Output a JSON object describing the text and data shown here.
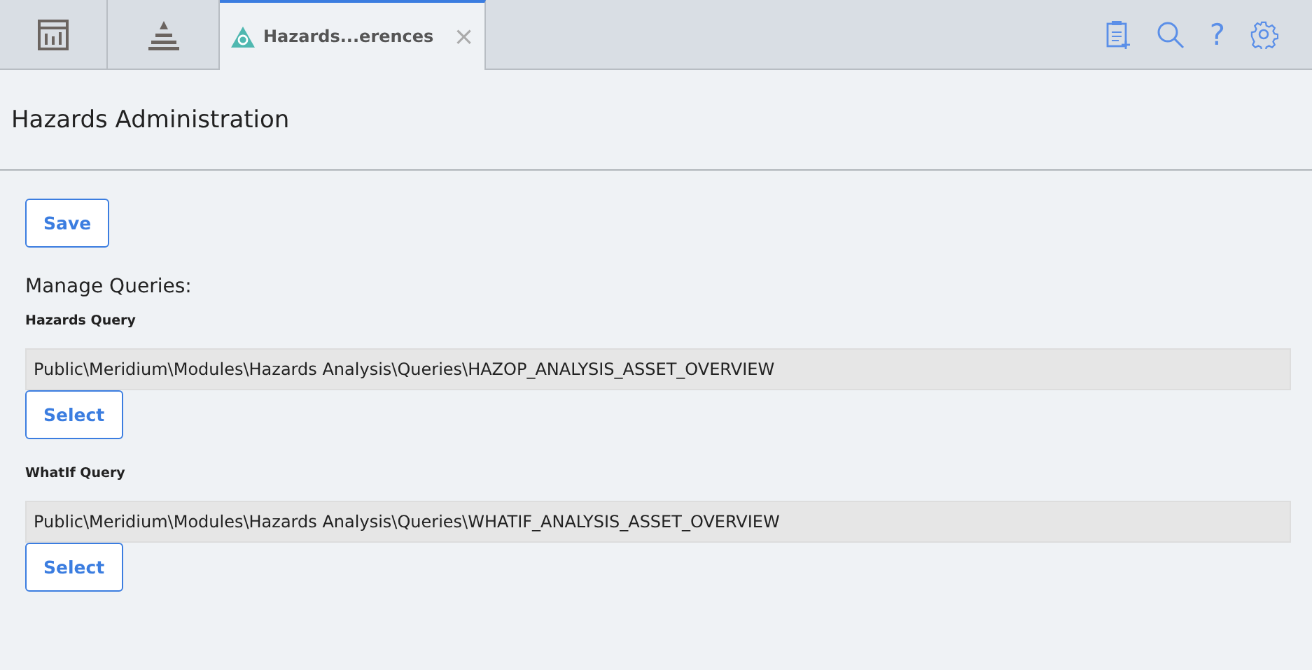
{
  "tabs": [
    {
      "kind": "report",
      "selected": false
    },
    {
      "kind": "pyramid",
      "selected": false
    },
    {
      "kind": "hazards",
      "label": "Hazards...erences",
      "close": "×",
      "selected": true
    }
  ],
  "toolbar": [
    {
      "kind": "clipboard"
    },
    {
      "kind": "search"
    },
    {
      "kind": "help",
      "label": "?"
    },
    {
      "kind": "settings"
    }
  ],
  "page_title": "Hazards Administration",
  "save_button": "Save",
  "section_label": "Manage Queries:",
  "queries": [
    {
      "label": "Hazards Query",
      "path": "Public\\Meridium\\Modules\\Hazards Analysis\\Queries\\HAZOP_ANALYSIS_ASSET_OVERVIEW",
      "button": "Select"
    },
    {
      "label": "WhatIf Query",
      "path": "Public\\Meridium\\Modules\\Hazards Analysis\\Queries\\WHATIF_ANALYSIS_ASSET_OVERVIEW",
      "button": "Select"
    }
  ]
}
